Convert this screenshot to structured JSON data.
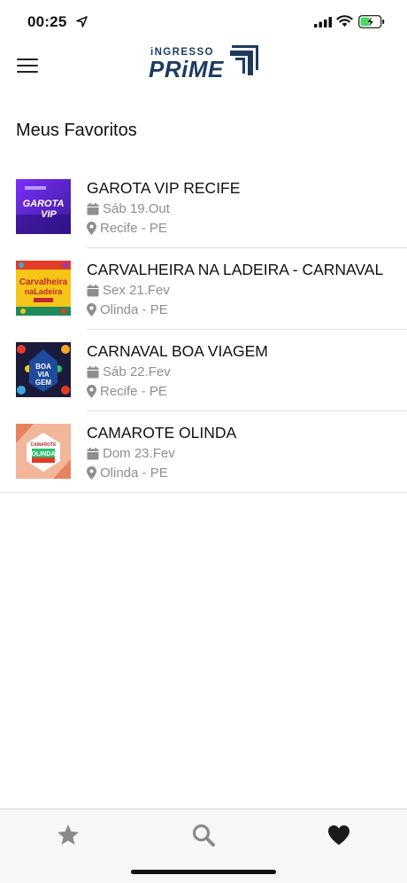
{
  "status_bar": {
    "time": "00:25"
  },
  "header": {
    "logo_top": "iNGRESSO",
    "logo_bottom": "PRiME"
  },
  "page": {
    "title": "Meus Favoritos"
  },
  "favorites": [
    {
      "name": "GAROTA VIP RECIFE",
      "date": "Sáb 19.Out",
      "location": "Recife - PE",
      "thumb_text": "GAROTA VIP"
    },
    {
      "name": "CARVALHEIRA NA LADEIRA - CARNAVAL",
      "date": "Sex 21.Fev",
      "location": "Olinda - PE",
      "thumb_text": "Carvalheira na Ladeira"
    },
    {
      "name": "CARNAVAL BOA VIAGEM",
      "date": "Sáb 22.Fev",
      "location": "Recife - PE",
      "thumb_text": "BOA VIAGEM"
    },
    {
      "name": "CAMAROTE OLINDA",
      "date": "Dom 23.Fev",
      "location": "Olinda - PE",
      "thumb_text": "CAMAROTE OLINDA"
    }
  ],
  "tab_bar": {
    "items": [
      "star-icon",
      "search-icon",
      "heart-icon"
    ],
    "active": "heart-icon"
  },
  "colors": {
    "brand": "#1d3a5e",
    "muted_text": "#8e8e8e",
    "tab_icon": "#8a8a8a",
    "tab_active": "#1a1a1a"
  }
}
